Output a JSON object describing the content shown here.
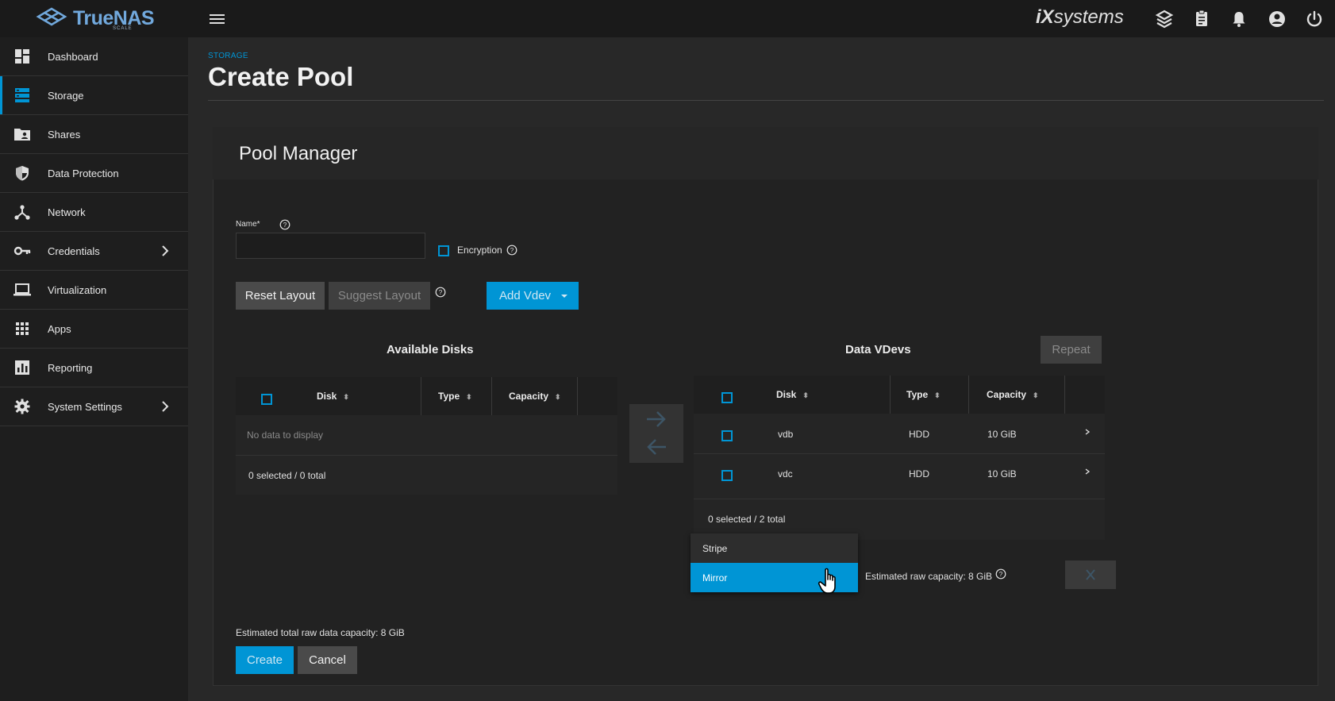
{
  "topbar": {
    "logo_text": "TrueNAS",
    "logo_sub": "SCALE",
    "vendor_logo_ix": "iX",
    "vendor_logo_text": "systems"
  },
  "sidebar": {
    "items": [
      {
        "label": "Dashboard",
        "icon": "dashboard-icon"
      },
      {
        "label": "Storage",
        "icon": "storage-icon",
        "active": true
      },
      {
        "label": "Shares",
        "icon": "shares-folder-icon"
      },
      {
        "label": "Data Protection",
        "icon": "shield-icon"
      },
      {
        "label": "Network",
        "icon": "network-icon"
      },
      {
        "label": "Credentials",
        "icon": "key-icon",
        "expandable": true
      },
      {
        "label": "Virtualization",
        "icon": "laptop-icon"
      },
      {
        "label": "Apps",
        "icon": "apps-grid-icon"
      },
      {
        "label": "Reporting",
        "icon": "chart-icon"
      },
      {
        "label": "System Settings",
        "icon": "gear-icon",
        "expandable": true
      }
    ]
  },
  "header": {
    "breadcrumb": "STORAGE",
    "title": "Create Pool"
  },
  "pool_manager": {
    "title": "Pool Manager",
    "name_label": "Name*",
    "name_value": "",
    "encryption_label": "Encryption",
    "reset_layout": "Reset Layout",
    "suggest_layout": "Suggest Layout",
    "add_vdev": "Add Vdev",
    "available_disks": {
      "title": "Available Disks",
      "columns": [
        "Disk",
        "Type",
        "Capacity"
      ],
      "empty_text": "No data to display",
      "footer": "0 selected / 0 total"
    },
    "data_vdevs": {
      "title": "Data VDevs",
      "repeat": "Repeat",
      "columns": [
        "Disk",
        "Type",
        "Capacity"
      ],
      "rows": [
        {
          "disk": "vdb",
          "type": "HDD",
          "capacity": "10 GiB"
        },
        {
          "disk": "vdc",
          "type": "HDD",
          "capacity": "10 GiB"
        }
      ],
      "footer": "0 selected / 2 total"
    },
    "layout_dropdown": {
      "options": [
        "Stripe",
        "Mirror"
      ],
      "selected": "Mirror"
    },
    "estimated_raw_capacity": "Estimated raw capacity: 8 GiB",
    "estimated_total": "Estimated total raw data capacity: 8 GiB",
    "create": "Create",
    "cancel": "Cancel"
  },
  "colors": {
    "accent": "#0095d5",
    "background": "#282828",
    "sidebar": "#1e1e1e",
    "topbar": "#1a1a1a"
  }
}
